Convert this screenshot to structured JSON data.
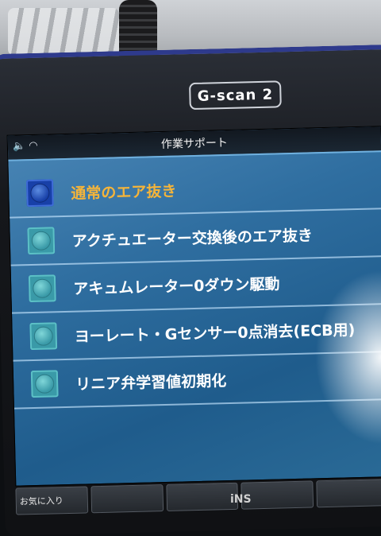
{
  "device": {
    "logo": "G-scan 2",
    "brand": "iNS"
  },
  "screen": {
    "title": "作業サポート",
    "status_icons": [
      "speaker-icon",
      "wifi-icon"
    ]
  },
  "menu": {
    "items": [
      {
        "label": "通常のエア抜き",
        "selected": true
      },
      {
        "label": "アクチュエーター交換後のエア抜き",
        "selected": false
      },
      {
        "label": "アキュムレーター0ダウン駆動",
        "selected": false
      },
      {
        "label": "ヨーレート・Gセンサー0点消去(ECB用)",
        "selected": false
      },
      {
        "label": "リニア弁学習値初期化",
        "selected": false
      }
    ]
  },
  "softkeys": [
    "お気に入り",
    "",
    "",
    "",
    ""
  ],
  "colors": {
    "selected_text": "#f4b43a",
    "screen_bg": "#2f6ea0",
    "bezel_accent": "#2e3a8c"
  }
}
